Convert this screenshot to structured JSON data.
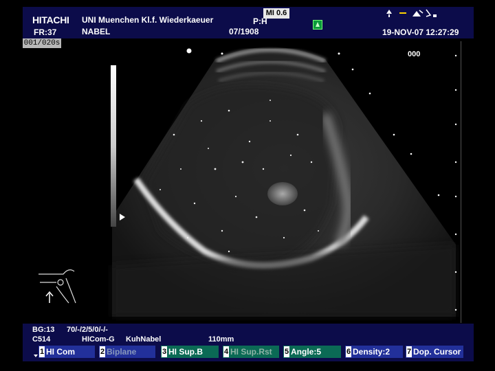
{
  "header": {
    "brand": "HITACHI",
    "frame_rate": "FR:37",
    "site": "UNI Muenchen Kl.f. Wiederkaeuer",
    "patient": "NABEL",
    "probe_mode": "P:H",
    "patient_id": "07/1908",
    "mi": "MI 0.6",
    "datetime": "19-NOV-07 12:27:29"
  },
  "clip_counter": "001/020s",
  "depth_marker": "000",
  "footer": {
    "gain": "BG:13",
    "dynamic": "70/-/2/5/0/-/-",
    "probe": "C514",
    "preset": "HICom-G",
    "organ": "KuhNabel",
    "depth": "110mm"
  },
  "softkeys": [
    {
      "num": "1",
      "label": "HI Com"
    },
    {
      "num": "2",
      "label": "Biplane"
    },
    {
      "num": "3",
      "label": "HI Sup.B"
    },
    {
      "num": "4",
      "label": "HI Sup.Rst"
    },
    {
      "num": "5",
      "label": "Angle:5"
    },
    {
      "num": "6",
      "label": "Density:2"
    },
    {
      "num": "7",
      "label": "Dop. Cursor"
    }
  ],
  "icons": [
    "probe-icon",
    "freeze-icon",
    "body-mark-icon",
    "focus-marker-icon"
  ],
  "colors": {
    "panel": "#0c0c4a",
    "softkey_blue": "#22309a",
    "softkey_green": "#0b6a55",
    "mi_box": "#e8e8e8"
  }
}
